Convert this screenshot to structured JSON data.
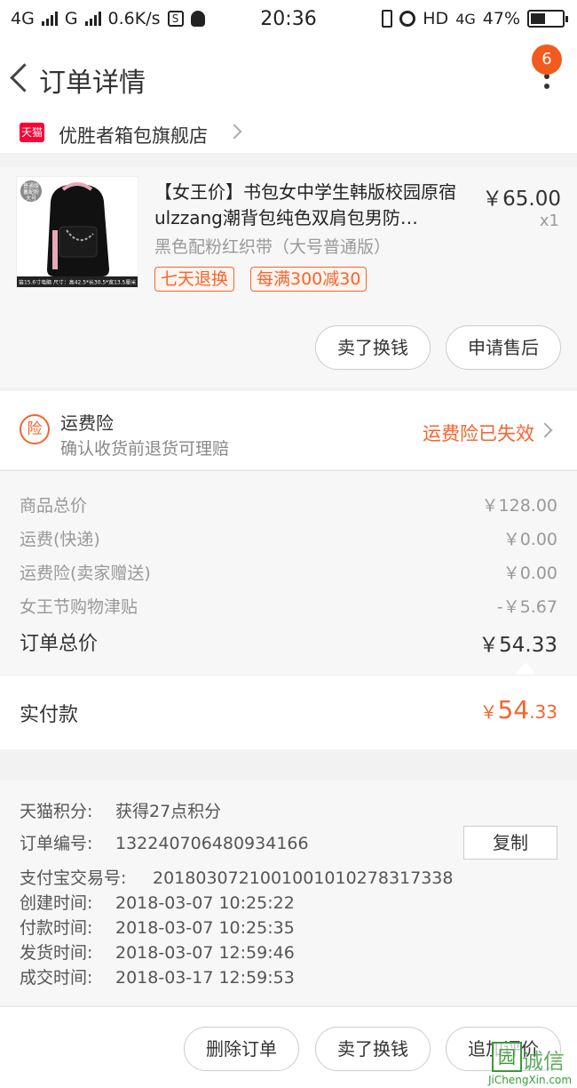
{
  "statusbar": {
    "network1": "4G",
    "network2": "G",
    "speed": "0.6K/s",
    "time": "20:36",
    "hd": "HD",
    "network3": "4G",
    "battery_text": "47%",
    "battery_level": 0.47
  },
  "navbar": {
    "title": "订单详情",
    "badge_count": "6"
  },
  "store": {
    "logo_text": "天猫",
    "name": "优胜者箱包旗舰店"
  },
  "product": {
    "thumb_caption": "笛15.6寸电脑 尺寸：高42.5*长30.5*宽13.5厘米",
    "thumb_badge": "普通版 蓄配粉 大号",
    "title": "【女王价】书包女中学生韩版校园原宿ulzzang潮背包纯色双肩包男防…",
    "price": "￥65.00",
    "qty": "x1",
    "sku": "黑色配粉红织带（大号普通版）",
    "tags": [
      "七天退换",
      "每满300减30"
    ],
    "buttons": [
      "卖了换钱",
      "申请售后"
    ]
  },
  "insurance": {
    "icon_text": "险",
    "title": "运费险",
    "subtitle": "确认收货前退货可理赔",
    "status": "运费险已失效"
  },
  "summary": {
    "rows": [
      {
        "label": "商品总价",
        "value": "￥128.00"
      },
      {
        "label": "运费(快递)",
        "value": "￥0.00"
      },
      {
        "label": "运费险(卖家赠送)",
        "value": "￥0.00"
      },
      {
        "label": "女王节购物津贴",
        "value": "-￥5.67"
      }
    ],
    "total_label": "订单总价",
    "total_value": "￥54.33"
  },
  "paid": {
    "label": "实付款",
    "currency": "￥",
    "integer": "54",
    "decimal": ".33"
  },
  "info": {
    "rows": [
      {
        "label": "天猫积分:",
        "value": "获得27点积分"
      },
      {
        "label": "订单编号:",
        "value": "132240706480934166"
      },
      {
        "label": "支付宝交易号:",
        "value": "2018030721001001010278317338"
      },
      {
        "label": "创建时间:",
        "value": "2018-03-07 10:25:22"
      },
      {
        "label": "付款时间:",
        "value": "2018-03-07 10:25:35"
      },
      {
        "label": "发货时间:",
        "value": "2018-03-07 12:59:46"
      },
      {
        "label": "成交时间:",
        "value": "2018-03-17 12:59:53"
      }
    ],
    "copy_label": "复制"
  },
  "bottom": {
    "buttons": [
      "删除订单",
      "卖了换钱",
      "追加评价"
    ]
  },
  "watermark": {
    "logo": "园",
    "text": "诚信",
    "url": "JiChengXin.com"
  },
  "colors": {
    "accent": "#f5642e",
    "badge": "#f35a1e",
    "tmall": "#ff0036"
  }
}
